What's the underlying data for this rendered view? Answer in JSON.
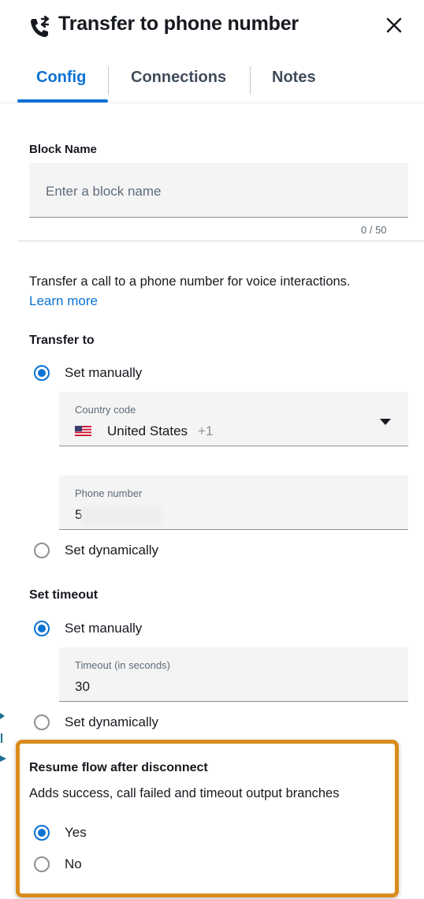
{
  "header": {
    "title": "Transfer to phone number",
    "icon": "phone-transfer-icon",
    "close_icon": "close-icon"
  },
  "tabs": [
    {
      "label": "Config",
      "active": true
    },
    {
      "label": "Connections",
      "active": false
    },
    {
      "label": "Notes",
      "active": false
    }
  ],
  "block_name": {
    "label": "Block Name",
    "placeholder": "Enter a block name",
    "value": "",
    "counter": "0 / 50"
  },
  "description": {
    "text": "Transfer a call to a phone number for voice interactions.",
    "link": "Learn more"
  },
  "transfer_to": {
    "heading": "Transfer to",
    "option_manual": "Set manually",
    "option_dynamic": "Set dynamically",
    "selected": "Set manually",
    "country": {
      "label": "Country code",
      "value": "United States",
      "dial_code": "+1",
      "flag": "us-flag-icon"
    },
    "phone": {
      "label": "Phone number",
      "value": "5"
    }
  },
  "timeout": {
    "heading": "Set timeout",
    "option_manual": "Set manually",
    "option_dynamic": "Set dynamically",
    "selected": "Set manually",
    "field": {
      "label": "Timeout (in seconds)",
      "value": "30"
    }
  },
  "resume": {
    "heading": "Resume flow after disconnect",
    "description": "Adds success, call failed and timeout output branches",
    "option_yes": "Yes",
    "option_no": "No",
    "selected": "Yes"
  },
  "colors": {
    "accent": "#0972d3",
    "highlight": "#d98c1c",
    "text": "#16191f",
    "muted": "#5f6b7a"
  }
}
